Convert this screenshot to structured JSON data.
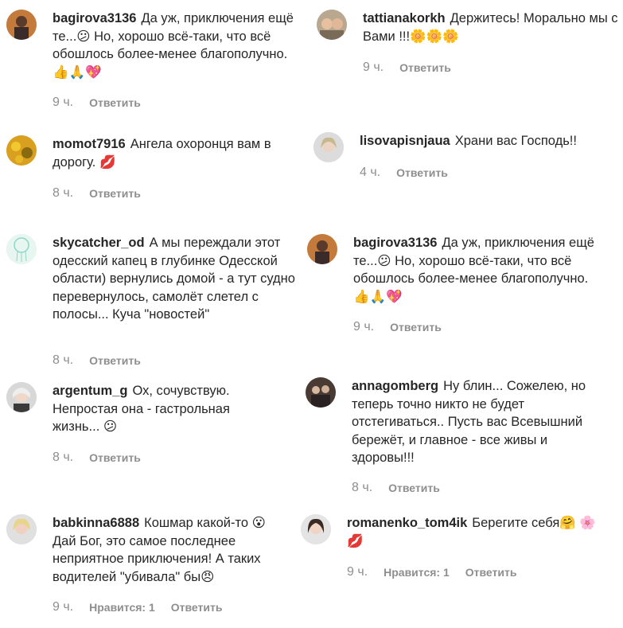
{
  "reply_label": "Ответить",
  "comments": [
    {
      "user": "bagirova3136",
      "text": "Да уж, приключения ещё те...😕 Но, хорошо всё-таки, что всё обошлось более-менее благополучно.👍🙏💖",
      "time": "9 ч.",
      "likes": ""
    },
    {
      "user": "tattianakorkh",
      "text": "Держитесь! Морально мы с Вами !!!🌼🌼🌼",
      "time": "9 ч.",
      "likes": ""
    },
    {
      "user": "momot7916",
      "text": "Ангела охоронця вам в дорогу. 💋",
      "time": "8 ч.",
      "likes": ""
    },
    {
      "user": "lisovapisnjaua",
      "text": "Храни вас Господь!!",
      "time": "4 ч.",
      "likes": ""
    },
    {
      "user": "skycatcher_od",
      "text": "А мы переждали этот одесский капец в глубинке Одесской области) вернулись домой - а тут судно перевернулось, самолёт слетел с полосы... Куча \"новостей\"",
      "time": "8 ч.",
      "likes": ""
    },
    {
      "user": "bagirova3136",
      "text": "Да уж, приключения ещё те...😕 Но, хорошо всё-таки, что всё обошлось более-менее благополучно.👍🙏💖",
      "time": "9 ч.",
      "likes": ""
    },
    {
      "user": "argentum_g",
      "text": "Ох, сочувствую. Непростая она - гастрольная жизнь... 😕",
      "time": "8 ч.",
      "likes": ""
    },
    {
      "user": "annagomberg",
      "text": "Ну блин... Сожелею, но теперь точно никто не будет отстегиваться.. Пусть вас Всевышний бережёт, и главное - все живы и здоровы!!!",
      "time": "8 ч.",
      "likes": ""
    },
    {
      "user": "babkinna6888",
      "text": "Кошмар какой-то 😮 Дай Бог, это самое последнее неприятное приключения! А таких водителей \"убивала\" бы😠",
      "time": "9 ч.",
      "likes": "Нравится: 1"
    },
    {
      "user": "romanenko_tom4ik",
      "text": "Берегите себя🤗 🌸💋",
      "time": "9 ч.",
      "likes": "Нравится: 1"
    }
  ],
  "colors": {
    "text": "#262626",
    "muted": "#8e8e8e",
    "background": "#ffffff"
  }
}
